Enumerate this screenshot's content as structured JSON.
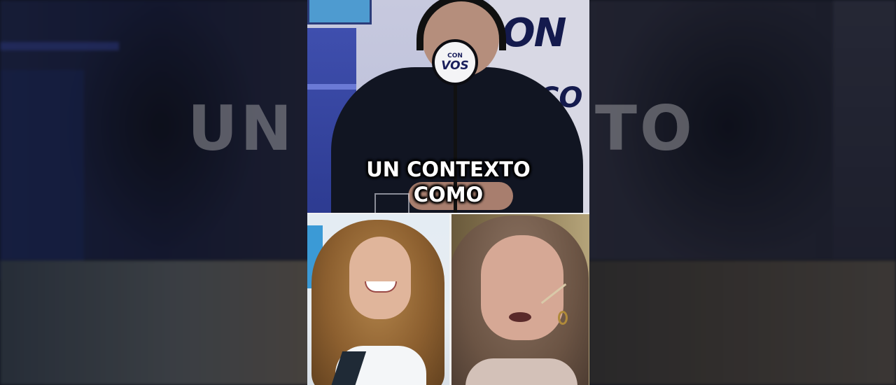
{
  "caption": {
    "line1": "UN CONTEXTO",
    "line2": "COMO"
  },
  "background_blur_text": {
    "word1": "UN",
    "word2": "TO"
  },
  "studio_branding": {
    "mic_flag_small": "CON",
    "mic_flag_large": "VOS",
    "wall_text_top": "ON",
    "wall_text_bottom": "CO"
  },
  "colors": {
    "caption_text": "#ffffff",
    "studio_blue": "#3f4fae",
    "brand_navy": "#1a1f5c",
    "divider": "#f2f2f2"
  }
}
